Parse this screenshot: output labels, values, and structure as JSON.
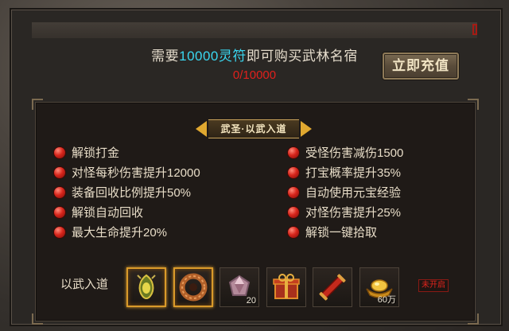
{
  "header": {
    "prefix": "需要",
    "amount": "10000灵符",
    "suffix": "即可购买武林名宿",
    "progress": "0/10000",
    "recharge_label": "立即充值"
  },
  "banner": {
    "title": "武圣·以武入道"
  },
  "benefits_left": [
    "解锁打金",
    "对怪每秒伤害提升12000",
    "装备回收比例提升50%",
    "解锁自动回收",
    "最大生命提升20%"
  ],
  "benefits_right": [
    "受怪伤害减伤1500",
    "打宝概率提升35%",
    "自动使用元宝经验",
    "对怪伤害提升25%",
    "解锁一键拾取"
  ],
  "items": {
    "label": "以武入道",
    "slots": [
      {
        "icon": "jade-amulet-icon",
        "count": ""
      },
      {
        "icon": "bronze-ring-icon",
        "count": ""
      },
      {
        "icon": "gem-icon",
        "count": "20"
      },
      {
        "icon": "gift-box-icon",
        "count": ""
      },
      {
        "icon": "scroll-icon",
        "count": ""
      },
      {
        "icon": "gold-ingot-icon",
        "count": "60万"
      }
    ],
    "status": "未开启"
  },
  "colors": {
    "highlight": "#3ad7f0",
    "progress": "#e0201c",
    "slot_glow": "#d99a2a"
  }
}
